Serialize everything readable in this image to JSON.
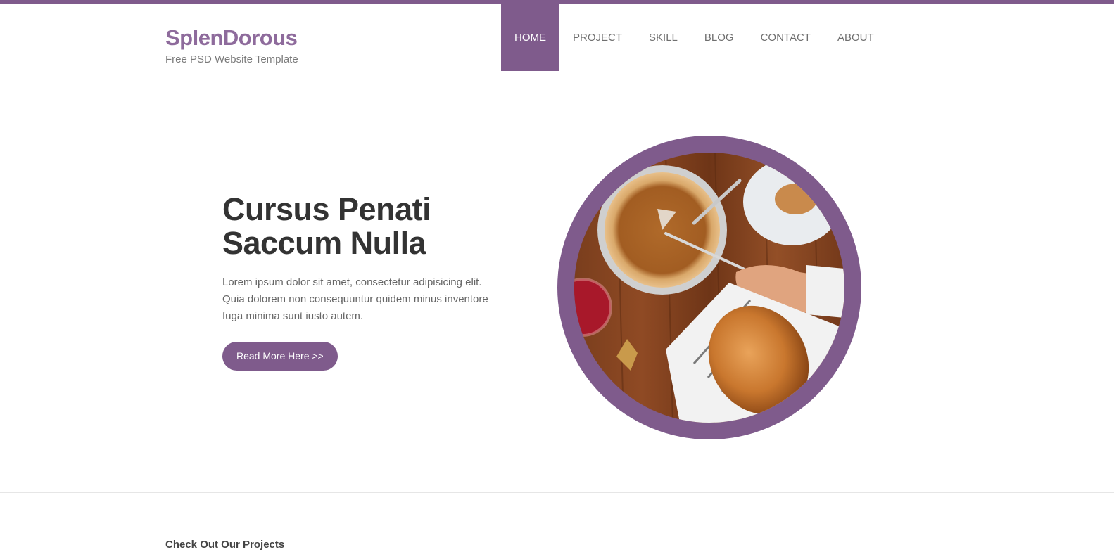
{
  "colors": {
    "accent": "#7f5b8c",
    "brand_text": "#8e6b9c",
    "heading": "#333333",
    "body_text": "#666666"
  },
  "header": {
    "brand_name": "SplenDorous",
    "tagline": "Free PSD Website Template"
  },
  "nav": {
    "items": [
      {
        "label": "HOME",
        "active": true
      },
      {
        "label": "PROJECT",
        "active": false
      },
      {
        "label": "SKILL",
        "active": false
      },
      {
        "label": "BLOG",
        "active": false
      },
      {
        "label": "CONTACT",
        "active": false
      },
      {
        "label": "ABOUT",
        "active": false
      }
    ]
  },
  "hero": {
    "title_line1": "Cursus Penati",
    "title_line2": "Saccum Nulla",
    "body": "Lorem ipsum dolor sit amet, consectetur adipisicing elit. Quia dolorem non consequuntur quidem minus inventore fuga minima sunt iusto autem.",
    "button_label": "Read More Here >>",
    "image": "circular food photo: pumpkin pie, braided bread, cranberry drink, hands with fork and knife on wooden table"
  },
  "projects": {
    "heading": "Check Out Our Projects"
  }
}
